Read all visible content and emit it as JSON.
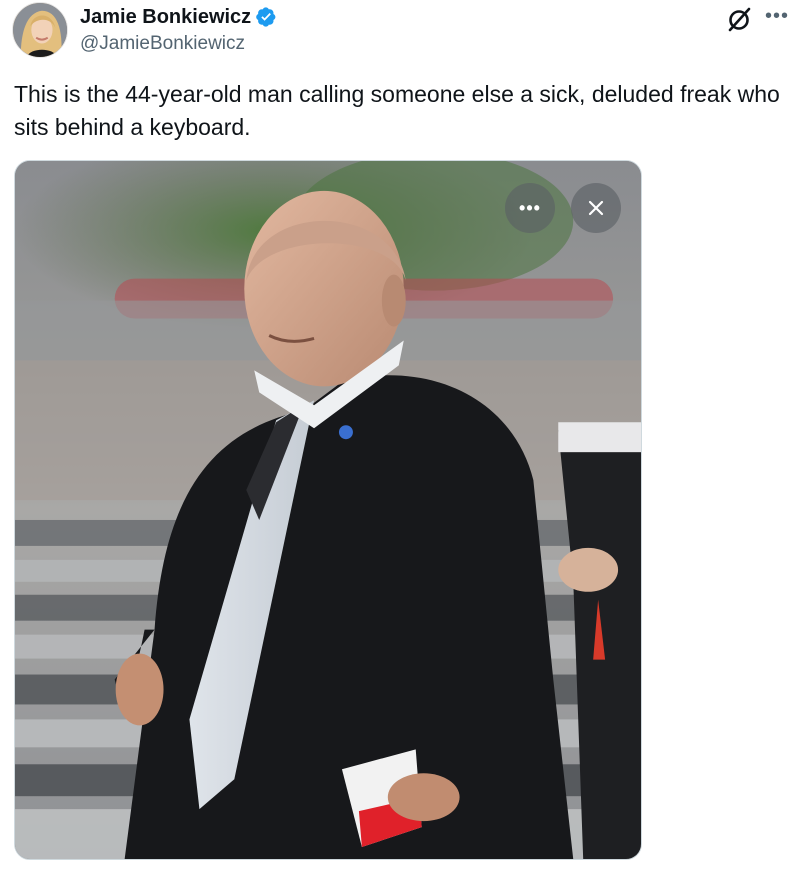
{
  "author": {
    "display_name": "Jamie Bonkiewicz",
    "handle": "@JamieBonkiewicz",
    "verified": true
  },
  "tweet": {
    "text": "This is the 44-year-old man calling someone else a sick, deluded freak who sits behind a keyboard."
  },
  "media": {
    "more_label": "•••",
    "close_label": "✕"
  },
  "header": {
    "more_label": "•••"
  },
  "icons": {
    "verified": "verified-badge-icon",
    "grok": "grok-icon",
    "more": "more-horizontal-icon",
    "close": "close-icon"
  },
  "colors": {
    "verified_blue": "#1d9bf0",
    "text_primary": "#0f1419",
    "text_secondary": "#536471"
  }
}
